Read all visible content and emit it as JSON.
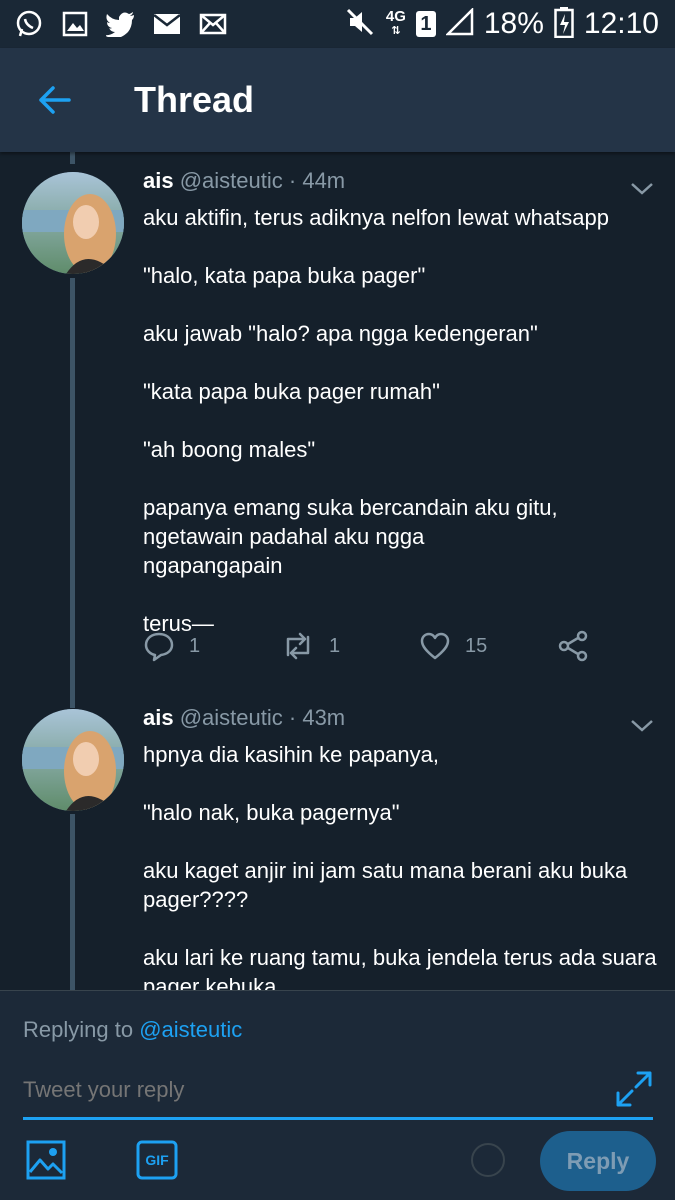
{
  "status_bar": {
    "network": "4G",
    "sim": "1",
    "battery": "18%",
    "time": "12:10",
    "icons": [
      "whatsapp-icon",
      "gallery-icon",
      "twitter-icon",
      "email-icon",
      "mail-icon",
      "mute-icon",
      "signal-icon",
      "battery-icon"
    ]
  },
  "header": {
    "title": "Thread",
    "back_icon": "back-arrow-icon"
  },
  "tweets": [
    {
      "name": "ais",
      "handle": "@aisteutic",
      "time": "· 44m",
      "lines": [
        "aku aktifin, terus adiknya nelfon lewat whatsapp",
        "\"halo, kata papa buka pager\"",
        "aku jawab \"halo? apa ngga kedengeran\"",
        "\"kata papa buka pager rumah\"",
        "\"ah boong males\"",
        "papanya emang suka bercandain aku gitu, ngetawain padahal aku ngga ngapangapain",
        "terus—"
      ],
      "replies": "1",
      "retweets": "1",
      "likes": "15"
    },
    {
      "name": "ais",
      "handle": "@aisteutic",
      "time": "· 43m",
      "lines": [
        "hpnya dia kasihin ke papanya,",
        "\"halo nak, buka pagernya\"",
        "aku kaget anjir ini jam satu mana berani aku buka pager????",
        "aku lari ke ruang tamu, buka jendela terus ada suara pager kebuka"
      ]
    }
  ],
  "composer": {
    "replying_prefix": "Replying to",
    "replying_mention": "@aisteutic",
    "placeholder": "Tweet your reply",
    "gif_label": "GIF",
    "reply_label": "Reply"
  },
  "colors": {
    "background": "#15202b",
    "header": "#243447",
    "accent": "#1da1f2",
    "muted": "#8899a6",
    "reply_button": "#1d5f8d"
  }
}
